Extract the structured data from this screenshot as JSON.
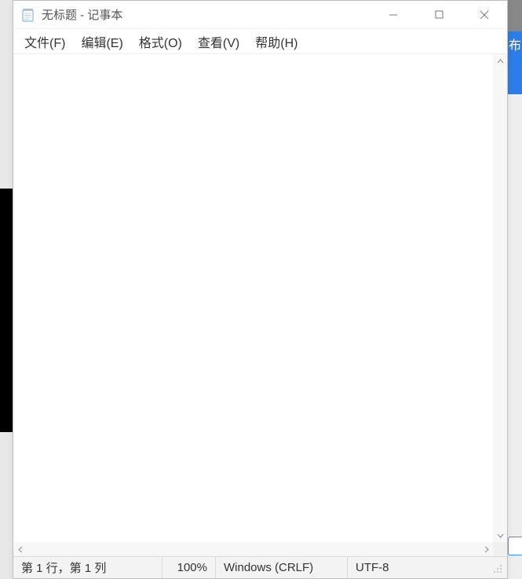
{
  "window": {
    "title": "无标题 - 记事本"
  },
  "menubar": {
    "file": "文件(F)",
    "edit": "编辑(E)",
    "format": "格式(O)",
    "view": "查看(V)",
    "help": "帮助(H)"
  },
  "editor": {
    "content": ""
  },
  "statusbar": {
    "position": "第 1 行，第 1 列",
    "zoom": "100%",
    "line_ending": "Windows (CRLF)",
    "encoding": "UTF-8"
  },
  "background": {
    "right_tab_fragment": "布"
  }
}
